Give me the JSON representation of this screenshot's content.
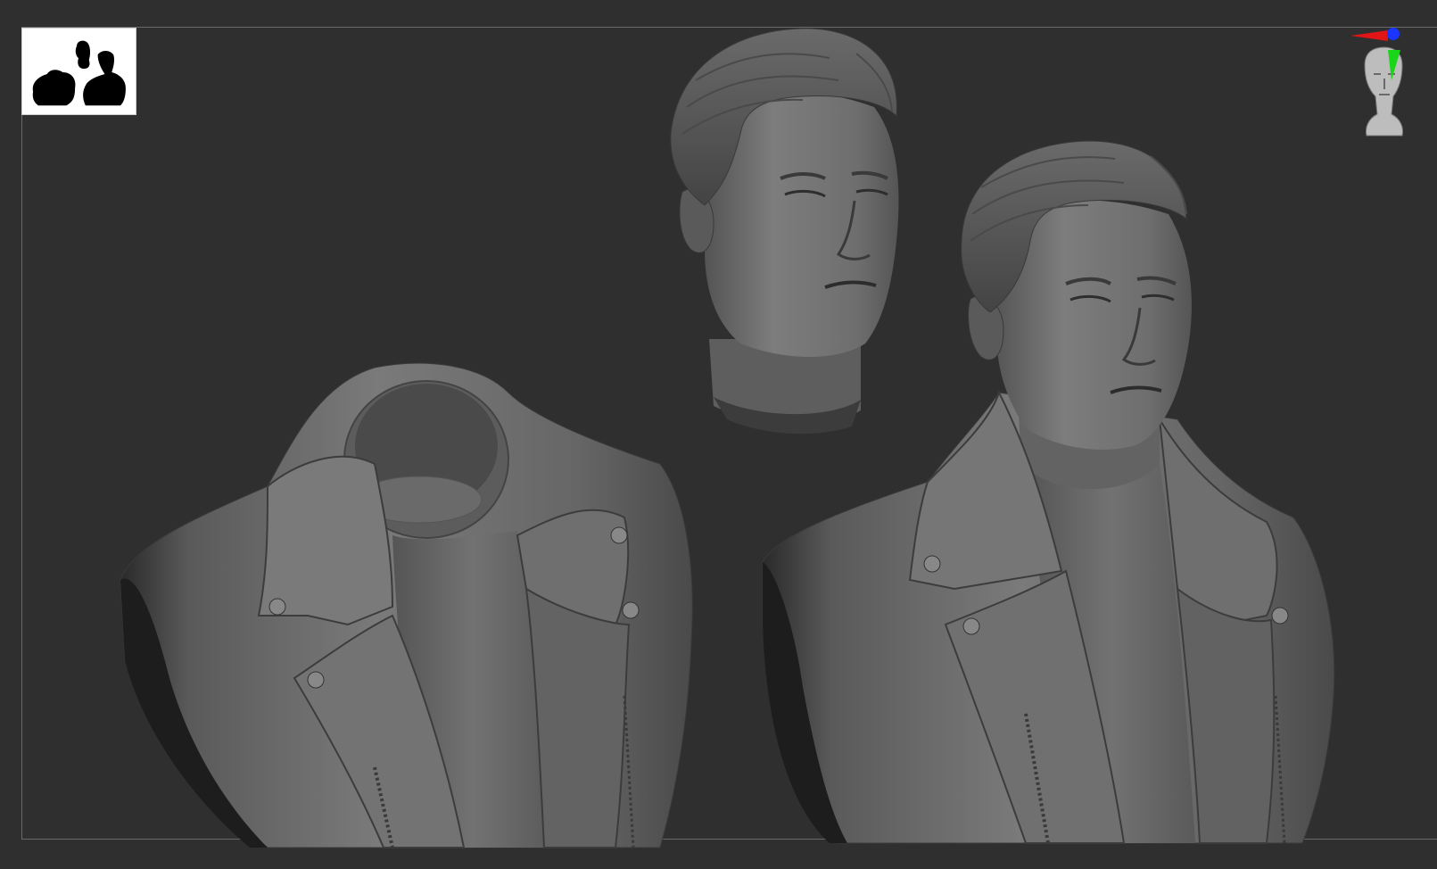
{
  "viewport": {
    "background_color": "#2f2f2f",
    "frame_color": "#6a6a6a"
  },
  "thumbnail": {
    "icon": "subtools-silhouette-icon",
    "background_color": "#ffffff",
    "silhouette_color": "#000000"
  },
  "navigation": {
    "icon": "head-orientation-gizmo-icon",
    "axis_colors": {
      "x": "#e01515",
      "y": "#19d619",
      "z": "#1a35ff"
    }
  },
  "models": [
    {
      "name": "jacket-bust-icon"
    },
    {
      "name": "head-icon"
    },
    {
      "name": "full-bust-icon"
    }
  ],
  "material": {
    "clay_color": "#6e6e6e",
    "shadow_color": "#1e1e1e",
    "highlight_color": "#9a9a9a"
  }
}
